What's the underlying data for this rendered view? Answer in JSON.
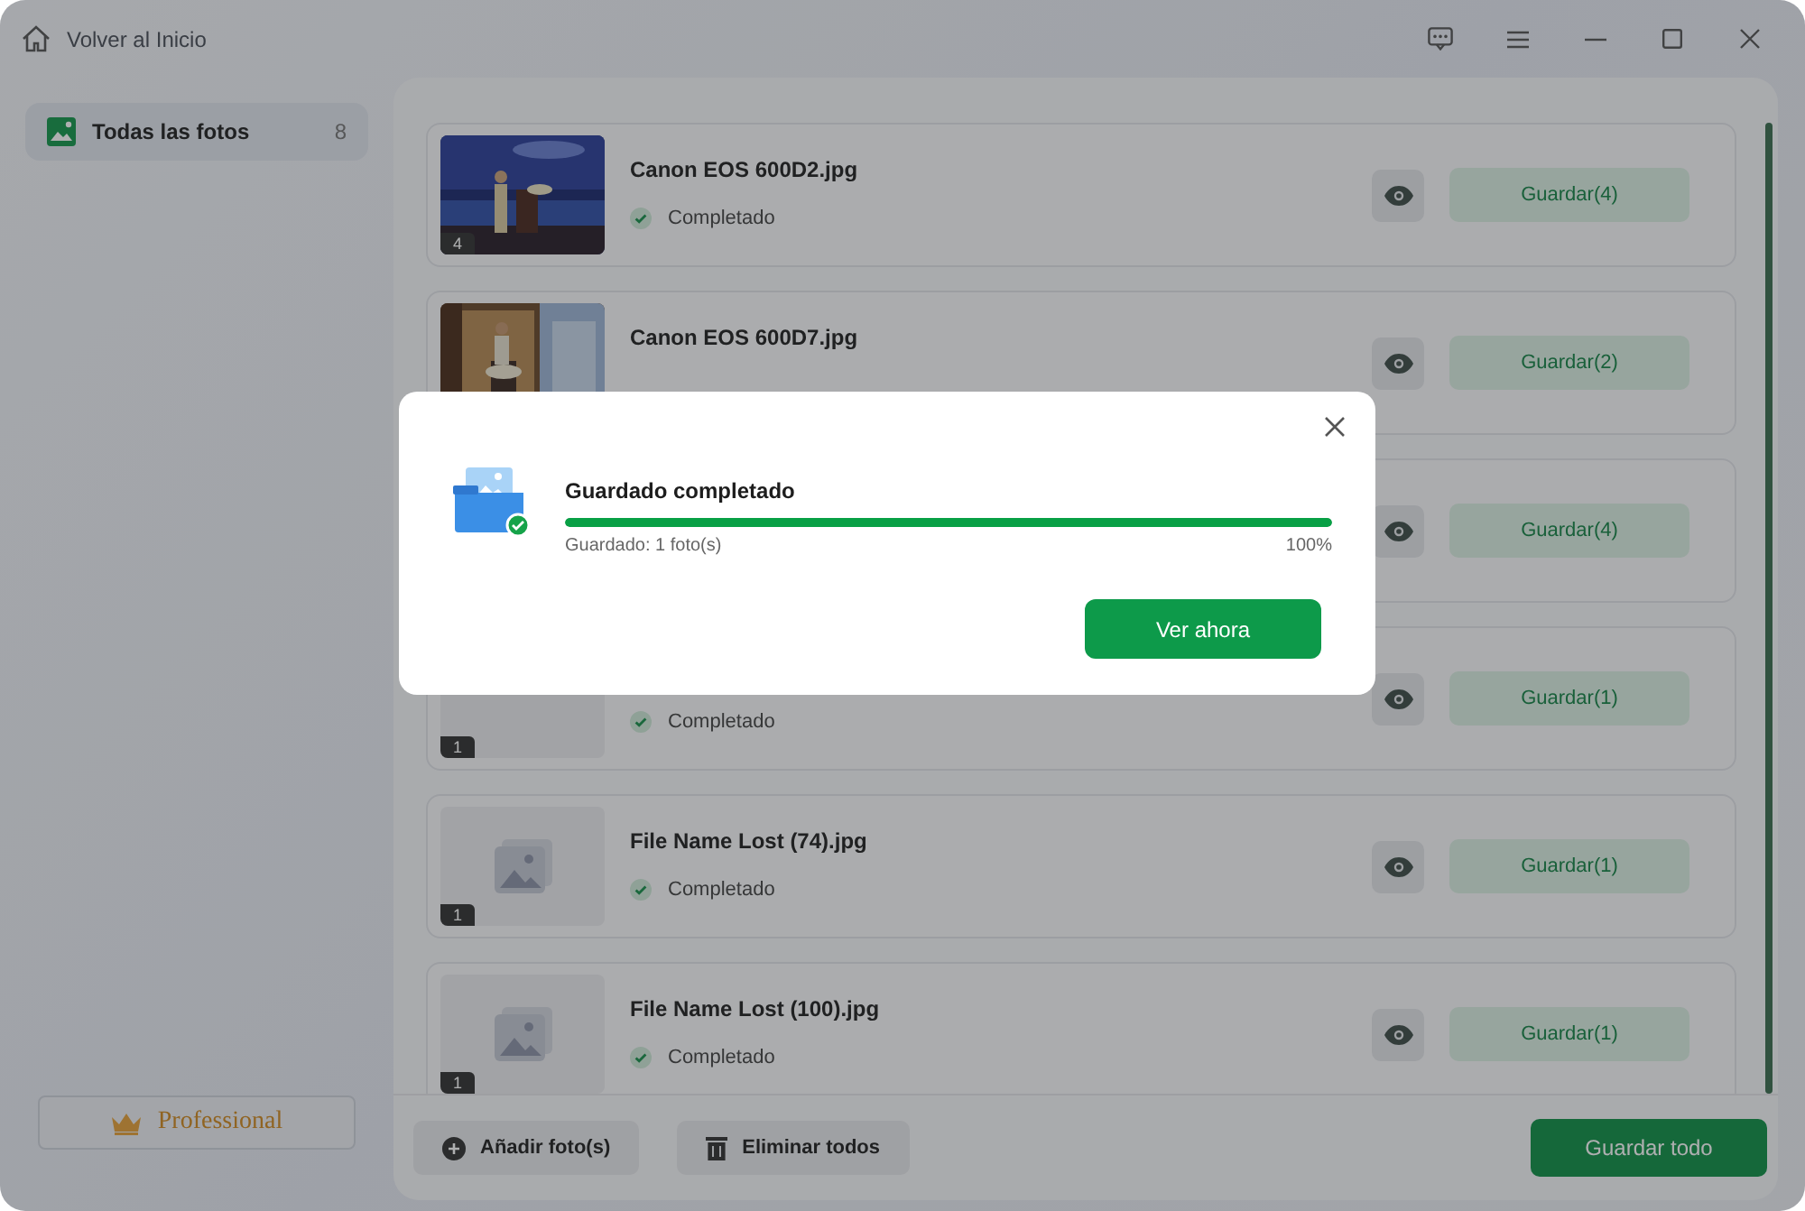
{
  "titlebar": {
    "back_label": "Volver al Inicio"
  },
  "sidebar": {
    "items": [
      {
        "label": "Todas las fotos",
        "count": "8",
        "selected": true
      }
    ],
    "upgrade_label": "Professional"
  },
  "files": [
    {
      "kind": "picture",
      "badge": "4",
      "name": "Canon EOS 600D2.jpg",
      "status": "Completado",
      "save_label": "Guardar(4)"
    },
    {
      "kind": "picture",
      "name": "Canon EOS 600D7.jpg",
      "save_label": "Guardar(2)"
    },
    {
      "save_label": "Guardar(4)"
    },
    {
      "badge": "1",
      "status": "Completado",
      "save_label": "Guardar(1)"
    },
    {
      "kind": "placeholder",
      "badge": "1",
      "name": "File Name Lost (74).jpg",
      "status": "Completado",
      "save_label": "Guardar(1)"
    },
    {
      "kind": "placeholder",
      "badge": "1",
      "name": "File Name Lost (100).jpg",
      "status": "Completado",
      "save_label": "Guardar(1)"
    }
  ],
  "footer": {
    "add_label": "Añadir foto(s)",
    "delete_label": "Eliminar todos",
    "save_all_label": "Guardar todo"
  },
  "dialog": {
    "title": "Guardado completado",
    "level": 1,
    "detail": "Guardado: 1 foto(s)",
    "percent": "100%",
    "action_label": "Ver ahora"
  }
}
